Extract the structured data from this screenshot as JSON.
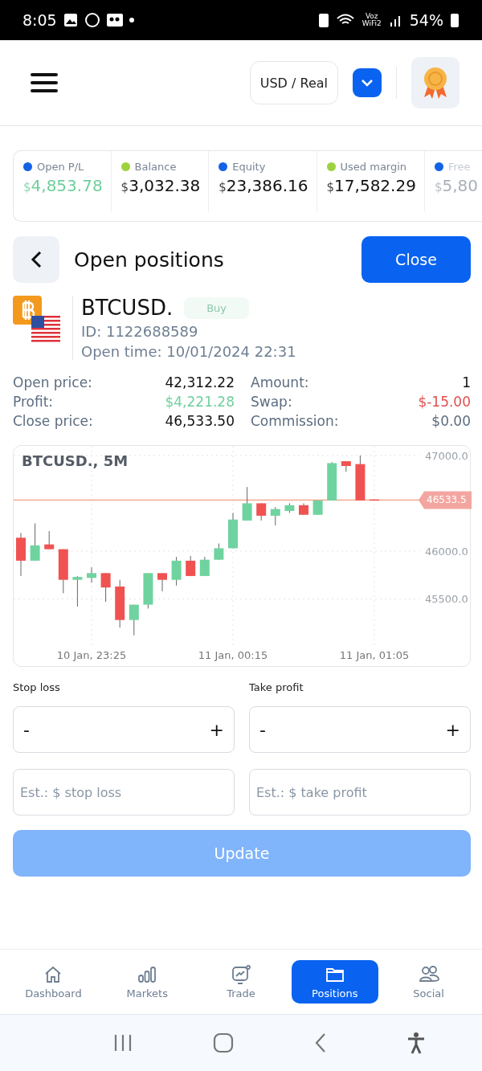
{
  "status_bar": {
    "time": "8:05",
    "network": "Voz WiFi2",
    "battery": "54%"
  },
  "header": {
    "account": "USD / Real"
  },
  "stats": [
    {
      "label": "Open P/L",
      "currency": "$",
      "value": "4,853.78",
      "color": "#1463e6",
      "positive": true,
      "faded": false
    },
    {
      "label": "Balance",
      "currency": "$",
      "value": "3,032.38",
      "color": "#9dd23f",
      "positive": false,
      "faded": false
    },
    {
      "label": "Equity",
      "currency": "$",
      "value": "23,386.16",
      "color": "#1463e6",
      "positive": false,
      "faded": false
    },
    {
      "label": "Used margin",
      "currency": "$",
      "value": "17,582.29",
      "color": "#9dd23f",
      "positive": false,
      "faded": false
    },
    {
      "label": "Free",
      "currency": "$",
      "value": "5,80",
      "color": "#1463e6",
      "positive": false,
      "faded": true
    }
  ],
  "page": {
    "title": "Open positions",
    "close_button": "Close"
  },
  "position": {
    "symbol": "BTCUSD.",
    "side": "Buy",
    "id": "ID: 1122688589",
    "open_time": "Open time: 10/01/2024 22:31"
  },
  "details": [
    {
      "label": "Open price:",
      "value": "42,312.22",
      "gain": false,
      "loss": false
    },
    {
      "label": "Amount:",
      "value": "1",
      "gain": false,
      "loss": false
    },
    {
      "label": "Profit:",
      "value": "$4,221.28",
      "gain": true,
      "loss": false
    },
    {
      "label": "Swap:",
      "value": "$-15.00",
      "gain": false,
      "loss": true
    },
    {
      "label": "Close price:",
      "value": "46,533.50",
      "gain": false,
      "loss": false
    },
    {
      "label": "Commission:",
      "value": "$0.00",
      "gain": false,
      "loss": false
    }
  ],
  "chart": {
    "title": "BTCUSD., 5M",
    "chart_data": {
      "type": "candlestick",
      "grid": true,
      "categories": [
        null,
        null,
        null,
        null,
        null,
        "10 Jan, 23:25",
        null,
        null,
        null,
        null,
        null,
        null,
        null,
        null,
        null,
        "11 Jan, 00:15",
        null,
        null,
        null,
        null,
        null,
        null,
        null,
        null,
        null,
        "11 Jan, 01:05"
      ],
      "ylim": [
        45000,
        47100
      ],
      "ohlc": [
        [
          46140,
          46190,
          45740,
          45900
        ],
        [
          45900,
          46290,
          45900,
          46060
        ],
        [
          46070,
          46210,
          46020,
          46020
        ],
        [
          46020,
          46020,
          45560,
          45700
        ],
        [
          45700,
          45740,
          45420,
          45730
        ],
        [
          45720,
          45830,
          45670,
          45770
        ],
        [
          45770,
          45770,
          45470,
          45620
        ],
        [
          45630,
          45700,
          45200,
          45280
        ],
        [
          45280,
          45440,
          45120,
          45440
        ],
        [
          45440,
          45770,
          45400,
          45770
        ],
        [
          45770,
          45770,
          45580,
          45700
        ],
        [
          45700,
          45940,
          45640,
          45900
        ],
        [
          45900,
          45950,
          45740,
          45740
        ],
        [
          45740,
          45940,
          45740,
          45910
        ],
        [
          45910,
          46080,
          45910,
          46030
        ],
        [
          46030,
          46400,
          46030,
          46330
        ],
        [
          46320,
          46670,
          46320,
          46500
        ],
        [
          46500,
          46500,
          46320,
          46370
        ],
        [
          46370,
          46460,
          46270,
          46440
        ],
        [
          46420,
          46500,
          46400,
          46480
        ],
        [
          46480,
          46500,
          46380,
          46380
        ],
        [
          46380,
          46530,
          46380,
          46530
        ],
        [
          46530,
          46930,
          46530,
          46920
        ],
        [
          46940,
          46940,
          46830,
          46890
        ],
        [
          46910,
          47000,
          46530,
          46530
        ],
        [
          46540,
          46540,
          46530,
          46530
        ]
      ],
      "yticks": [
        {
          "value": 47000,
          "label": "47000.0"
        },
        {
          "value": 46000,
          "label": "46000.0"
        },
        {
          "value": 45500,
          "label": "45500.0"
        }
      ],
      "ref_lines": [
        {
          "axis": "y",
          "value": 46533.5,
          "label": "46533.5"
        }
      ]
    }
  },
  "orders": [
    {
      "label": "Stop loss",
      "minus": "-",
      "plus": "+",
      "placeholder": "Est.: $ stop loss"
    },
    {
      "label": "Take profit",
      "minus": "-",
      "plus": "+",
      "placeholder": "Est.: $ take profit"
    }
  ],
  "update_button": {
    "label": "Update",
    "disabled": true
  },
  "nav": [
    {
      "label": "Dashboard",
      "kind": "home",
      "selected": false
    },
    {
      "label": "Markets",
      "kind": "bars",
      "selected": false
    },
    {
      "label": "Trade",
      "kind": "trade",
      "selected": false
    },
    {
      "label": "Positions",
      "kind": "folder",
      "selected": true
    },
    {
      "label": "Social",
      "kind": "people",
      "selected": false
    }
  ]
}
